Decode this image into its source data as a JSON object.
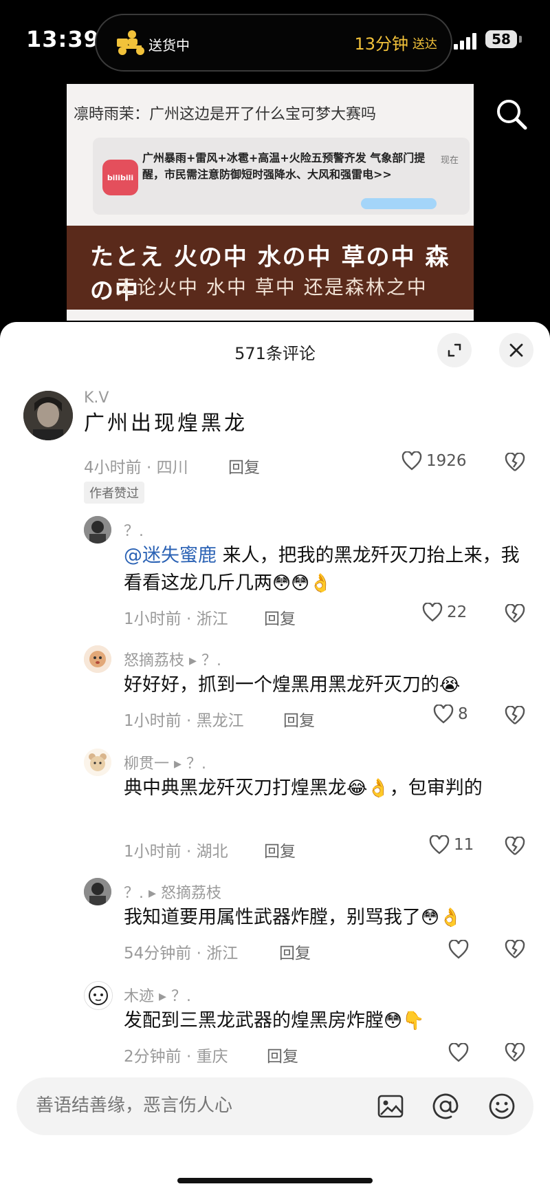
{
  "status_bar": {
    "time": "13:39",
    "delivery_status": "送货中",
    "eta_minutes": "13分钟",
    "eta_label": "送达",
    "battery": "58"
  },
  "video": {
    "caption": "凛時雨茉：广州这边是开了什么宝可梦大赛吗",
    "notification": {
      "app": "bilibili",
      "text": "广州暴雨+雷风+冰雹+高温+火险五预警齐发 气象部门提醒，市民需注意防御短时强降水、大风和强雷电>>",
      "time": "现在"
    },
    "subtitle_jp": "たとえ 火の中 水の中 草の中 森の中",
    "subtitle_cn": "无论火中 水中 草中 还是森林之中"
  },
  "comments_panel": {
    "title": "571条评论",
    "comments": [
      {
        "user": "K.V",
        "text": "广州出现煌黑龙",
        "time_location": "4小时前 · 四川",
        "reply": "回复",
        "likes": "1926",
        "badge": "作者赞过"
      },
      {
        "user": "？.",
        "mention": "@迷失蜜鹿",
        "text": " 来人，把我的黑龙歼灭刀抬上来，我看看这龙几斤几两",
        "emoji": "😳😳👌",
        "time_location": "1小时前 · 浙江",
        "reply": "回复",
        "likes": "22"
      },
      {
        "user": "怒摘荔枝",
        "reply_to": "▸ ？.",
        "text": "好好好，抓到一个煌黑用黑龙歼灭刀的",
        "emoji": "😭",
        "time_location": "1小时前 · 黑龙江",
        "reply": "回复",
        "likes": "8"
      },
      {
        "user": "柳贯一",
        "reply_to": "▸ ？.",
        "text": "典中典黑龙歼灭刀打煌黑龙",
        "emoji": "😂👌",
        "text_tail": "，包审判的",
        "time_location": "1小时前 · 湖北",
        "reply": "回复",
        "likes": "11"
      },
      {
        "user": "？.",
        "reply_to": "▸ 怒摘荔枝",
        "text": "我知道要用属性武器炸膛，别骂我了",
        "emoji": "😳👌",
        "time_location": "54分钟前 · 浙江",
        "reply": "回复"
      },
      {
        "user": "木迹",
        "reply_to": "▸ ？.",
        "text": "发配到三黑龙武器的煌黑房炸膛",
        "emoji": "😳👇",
        "time_location": "2分钟前 · 重庆",
        "reply": "回复"
      }
    ],
    "input": {
      "placeholder": "善语结善缘，恶言伤人心"
    }
  },
  "colors": {
    "accent_mention": "#2c63b5",
    "eta_yellow": "#f2c23a"
  }
}
